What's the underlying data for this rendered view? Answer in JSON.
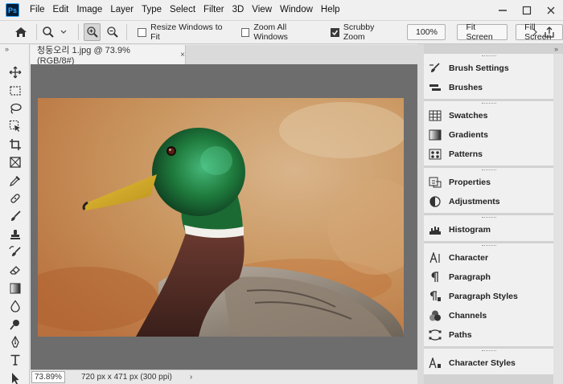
{
  "app": {
    "logo_text": "Ps"
  },
  "menu": [
    "File",
    "Edit",
    "Image",
    "Layer",
    "Type",
    "Select",
    "Filter",
    "3D",
    "View",
    "Window",
    "Help"
  ],
  "options": {
    "resize_windows": {
      "label": "Resize Windows to Fit",
      "checked": false
    },
    "zoom_all": {
      "label": "Zoom All Windows",
      "checked": false
    },
    "scrubby_zoom": {
      "label": "Scrubby Zoom",
      "checked": true
    },
    "zoom_100": "100%",
    "fit_screen": "Fit Screen",
    "fill_screen": "Fill Screen"
  },
  "document": {
    "tab_title": "청둥오리 1.jpg @ 73.9% (RGB/8#)",
    "close_glyph": "×"
  },
  "status": {
    "zoom": "73.89%",
    "info": "720 px x 471 px (300 ppi)",
    "arrow": "›"
  },
  "panels": {
    "group1": [
      "Brush Settings",
      "Brushes"
    ],
    "group2": [
      "Swatches",
      "Gradients",
      "Patterns"
    ],
    "group3": [
      "Properties",
      "Adjustments"
    ],
    "group4": [
      "Histogram"
    ],
    "group5": [
      "Character",
      "Paragraph",
      "Paragraph Styles",
      "Channels",
      "Paths"
    ],
    "group6": [
      "Character Styles"
    ]
  },
  "collapse_glyph": "»",
  "colors": {
    "accent": "#31a8ff",
    "canvas": "#6d6d6d"
  }
}
